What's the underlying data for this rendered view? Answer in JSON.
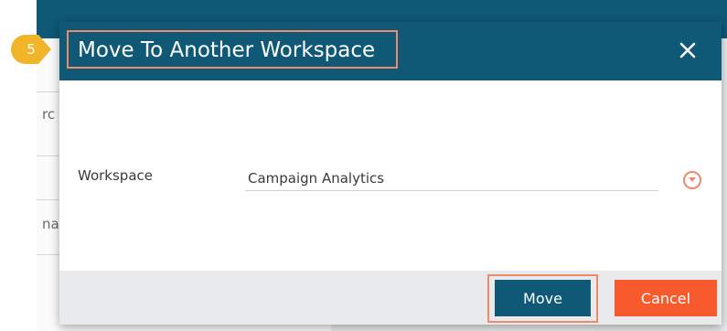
{
  "step": {
    "number": "5"
  },
  "background": {
    "partial_text_1": "rc",
    "partial_text_2": "na"
  },
  "dialog": {
    "title": "Move To Another Workspace",
    "close_icon": "close-icon",
    "field_label": "Workspace",
    "selected_workspace": "Campaign Analytics",
    "dropdown_icon": "chevron-down-circle-icon",
    "move_label": "Move",
    "cancel_label": "Cancel"
  },
  "colors": {
    "header": "#0f5876",
    "highlight": "#f0896a",
    "step_badge": "#f2b52a",
    "cancel": "#f65a2d",
    "footer": "#e9eaeb"
  }
}
